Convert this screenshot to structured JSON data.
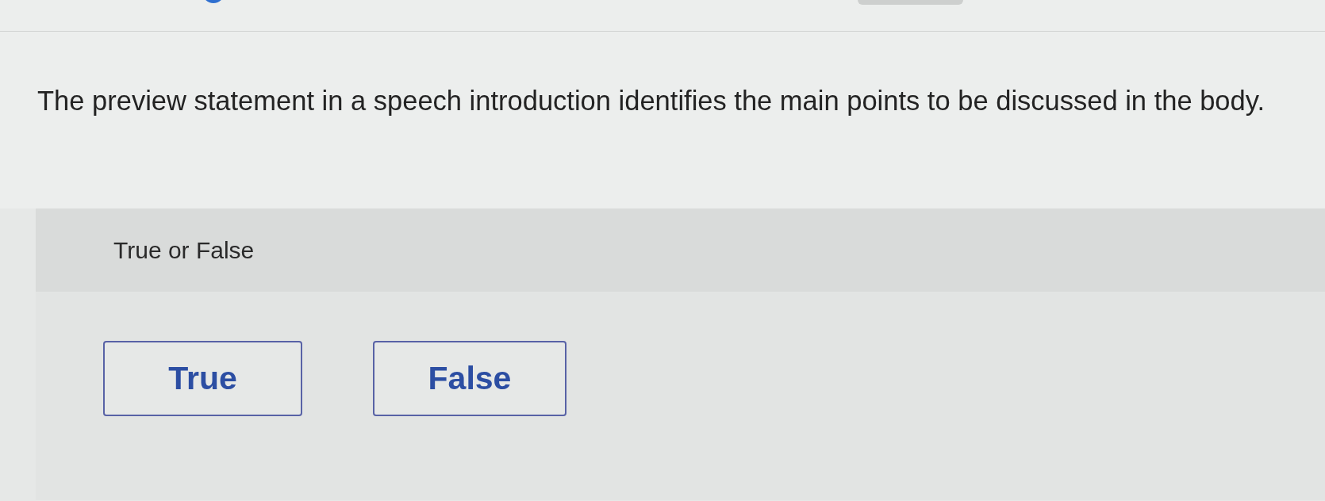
{
  "question": {
    "text": "The preview statement in a speech introduction identifies the main points to be discussed in the body."
  },
  "answer_panel": {
    "prompt": "True or False",
    "options": [
      {
        "label": "True",
        "selected": false
      },
      {
        "label": "False",
        "selected": false
      }
    ]
  }
}
